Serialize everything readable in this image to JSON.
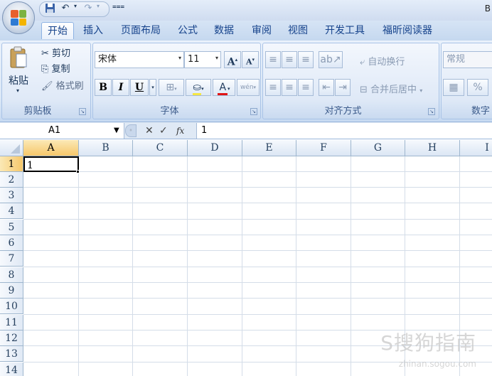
{
  "title": {
    "text_right": "B"
  },
  "tabs": [
    {
      "label": "开始",
      "active": true
    },
    {
      "label": "插入"
    },
    {
      "label": "页面布局"
    },
    {
      "label": "公式"
    },
    {
      "label": "数据"
    },
    {
      "label": "审阅"
    },
    {
      "label": "视图"
    },
    {
      "label": "开发工具"
    },
    {
      "label": "福昕阅读器"
    }
  ],
  "clipboard": {
    "paste": "粘贴",
    "cut": "剪切",
    "copy": "复制",
    "format_painter": "格式刷",
    "label": "剪贴板"
  },
  "font": {
    "name": "宋体",
    "size": "11",
    "bold": "B",
    "italic": "I",
    "underline": "U",
    "grow": "A",
    "shrink": "A",
    "font_color": "A",
    "phonetic": "wén",
    "label": "字体"
  },
  "alignment": {
    "wrap_text": "自动换行",
    "merge_center": "合并后居中",
    "label": "对齐方式"
  },
  "number": {
    "format": "常规",
    "percent": "%",
    "label": "数字"
  },
  "formula_bar": {
    "name_box": "A1",
    "fx": "fx",
    "content": "1"
  },
  "sheet": {
    "columns": [
      "A",
      "B",
      "C",
      "D",
      "E",
      "F",
      "G",
      "H",
      "I"
    ],
    "rows": [
      "1",
      "2",
      "3",
      "4",
      "5",
      "6",
      "7",
      "8",
      "9",
      "10",
      "11",
      "12",
      "13",
      "14"
    ],
    "selected_cell": "A1",
    "cells": {
      "A1": "1"
    }
  },
  "watermark": {
    "main": "S搜狗指南",
    "sub": "zhinan.sogou.com"
  },
  "colors": {
    "accent": "#15428b",
    "ribbon": "#dbe8f7",
    "selected_header": "#f6c76a"
  }
}
